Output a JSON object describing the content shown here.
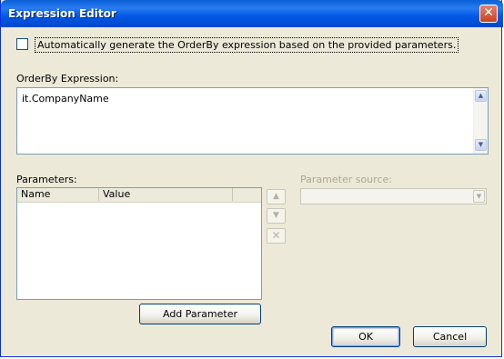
{
  "window": {
    "title": "Expression Editor",
    "close_glyph": "✕"
  },
  "auto_generate": {
    "checked": false,
    "label": "Automatically generate the OrderBy expression based on the provided parameters."
  },
  "orderby": {
    "label": "OrderBy Expression:",
    "value": "it.CompanyName"
  },
  "parameters": {
    "label": "Parameters:",
    "columns": [
      "Name",
      "Value"
    ],
    "rows": [],
    "add_button": "Add Parameter"
  },
  "side_buttons": {
    "up_icon": "arrow-up-icon",
    "down_icon": "arrow-down-icon",
    "remove_icon": "remove-x-icon"
  },
  "parameter_source": {
    "label": "Parameter source:",
    "selected": "",
    "enabled": false
  },
  "footer": {
    "ok": "OK",
    "cancel": "Cancel"
  },
  "colors": {
    "titlebar": "#0058e6",
    "dialog_bg": "#ece9d8",
    "disabled_text": "#aca899"
  }
}
